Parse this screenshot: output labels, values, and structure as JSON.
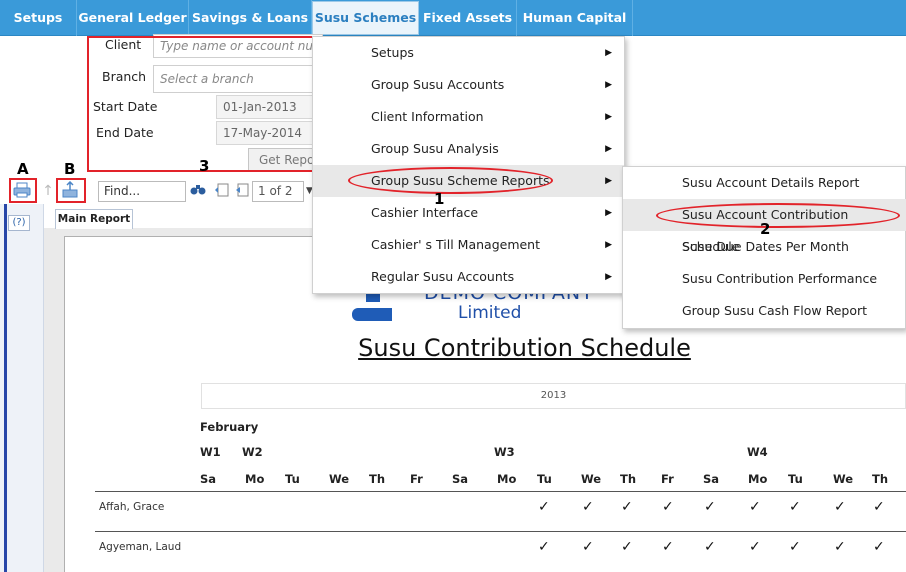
{
  "nav": {
    "items": [
      "Setups",
      "General Ledger",
      "Savings & Loans",
      "Susu Schemes",
      "Fixed Assets",
      "Human Capital"
    ],
    "active": "Susu Schemes"
  },
  "form": {
    "client_label": "Client",
    "client_placeholder": "Type name or account number",
    "branch_label": "Branch",
    "branch_placeholder": "Select a branch",
    "start_label": "Start Date",
    "start_value": "01-Jan-2013",
    "end_label": "End Date",
    "end_value": "17-May-2014",
    "get_report": "Get Report"
  },
  "annotations": {
    "a": "A",
    "b": "B",
    "three": "3",
    "one": "1",
    "two": "2"
  },
  "viewer": {
    "find_placeholder": "Find...",
    "page": "1 of 2",
    "help": "(?)",
    "tab": "Main Report"
  },
  "menu": {
    "items": [
      "Setups",
      "Group Susu Accounts",
      "Client Information",
      "Group Susu Analysis",
      "Group Susu Scheme Reports",
      "Cashier Interface",
      "Cashier' s Till Management",
      "Regular Susu Accounts"
    ],
    "highlighted": 4,
    "arrow": "▶"
  },
  "submenu": {
    "items": [
      "Susu Account Details Report",
      "Susu Account Contribution Schedule",
      "Susu Due Dates Per Month",
      "Susu Contribution Performance",
      "Group Susu Cash Flow Report"
    ],
    "highlighted": 1
  },
  "report": {
    "logo_line1": "DEMO COMPANY",
    "logo_line2": "Limited",
    "title": "Susu Contribution Schedule",
    "year": "2013",
    "month": "February",
    "weeks": [
      "W1",
      "W2",
      "W3",
      "W4"
    ],
    "days": [
      "Sa",
      "Mo",
      "Tu",
      "We",
      "Th",
      "Fr",
      "Sa",
      "Mo",
      "Tu",
      "We",
      "Th",
      "Fr",
      "Sa",
      "Mo",
      "Tu",
      "We",
      "Th"
    ],
    "rows": [
      {
        "name": "Affah, Grace",
        "checks": [
          "Tu",
          "We",
          "Th",
          "Fr",
          "Sa",
          "Mo",
          "Tu",
          "We",
          "Th"
        ]
      },
      {
        "name": "Agyeman, Laud",
        "checks": [
          "Tu",
          "We",
          "Th",
          "Fr",
          "Sa",
          "Mo",
          "Tu",
          "We",
          "Th"
        ]
      }
    ],
    "check_symbol": "✓"
  },
  "colors": {
    "nav_bg": "#3a9ad9",
    "highlight_red": "#e2232a",
    "logo_blue": "#1f4fa8"
  }
}
